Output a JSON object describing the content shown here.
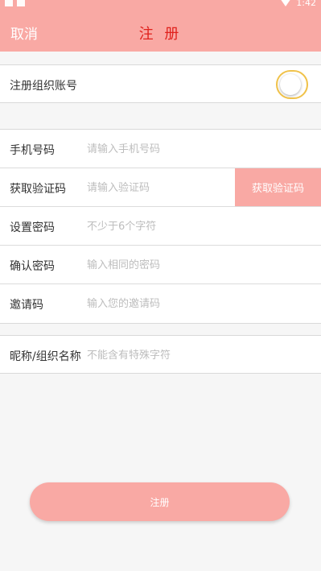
{
  "status_bar": {
    "time": "1:42"
  },
  "header": {
    "cancel_label": "取消",
    "title": "注 册"
  },
  "org_account": {
    "label": "注册组织账号",
    "toggle_on": false
  },
  "form": {
    "phone": {
      "label": "手机号码",
      "placeholder": "请输入手机号码"
    },
    "verify": {
      "label": "获取验证码",
      "placeholder": "请输入验证码",
      "button_label": "获取验证码"
    },
    "password": {
      "label": "设置密码",
      "placeholder": "不少于6个字符"
    },
    "confirm": {
      "label": "确认密码",
      "placeholder": "输入相同的密码"
    },
    "invite": {
      "label": "邀请码",
      "placeholder": "输入您的邀请码"
    }
  },
  "nickname": {
    "label": "昵称/组织名称",
    "placeholder": "不能含有特殊字符"
  },
  "register_label": "注册",
  "colors": {
    "accent": "#f9a9a4",
    "title": "#e0211c",
    "toggle_border": "#f0c24a"
  }
}
